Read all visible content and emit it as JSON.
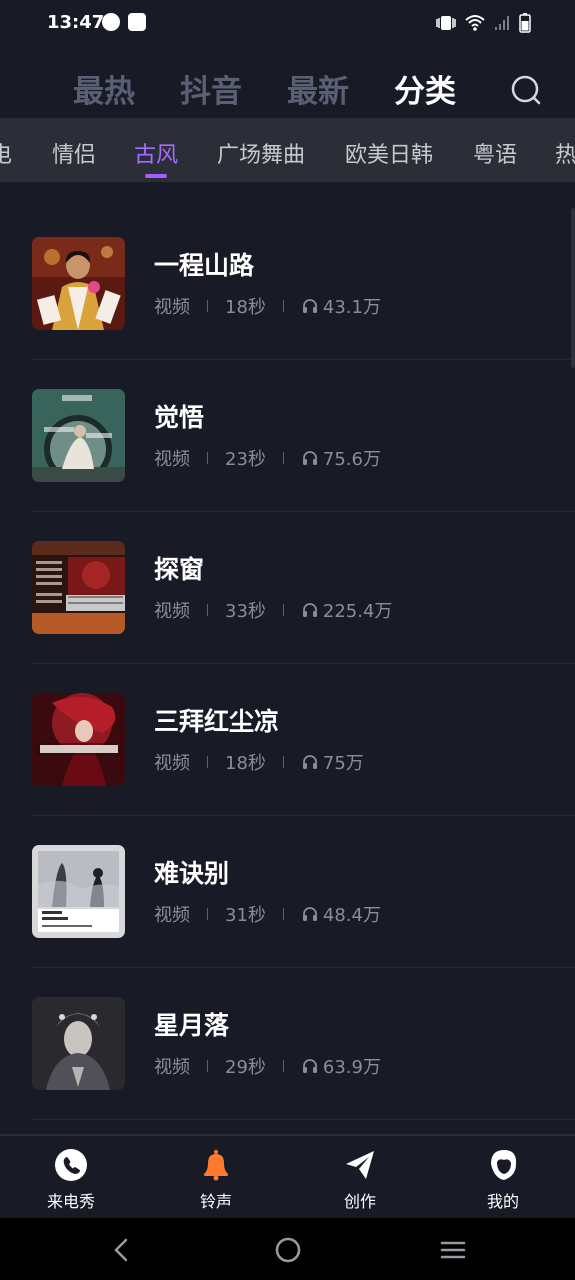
{
  "status": {
    "time": "13:47"
  },
  "top_tabs": [
    {
      "label": "最热"
    },
    {
      "label": "抖音"
    },
    {
      "label": "最新"
    },
    {
      "label": "分类",
      "active": true
    }
  ],
  "categories": [
    {
      "label": "电"
    },
    {
      "label": "情侣"
    },
    {
      "label": "古风",
      "active": true
    },
    {
      "label": "广场舞曲"
    },
    {
      "label": "欧美日韩"
    },
    {
      "label": "粤语"
    },
    {
      "label": "热"
    }
  ],
  "songs": [
    {
      "title": "一程山路",
      "type": "视频",
      "duration": "18秒",
      "plays": "43.1万"
    },
    {
      "title": "觉悟",
      "type": "视频",
      "duration": "23秒",
      "plays": "75.6万"
    },
    {
      "title": "探窗",
      "type": "视频",
      "duration": "33秒",
      "plays": "225.4万"
    },
    {
      "title": "三拜红尘凉",
      "type": "视频",
      "duration": "18秒",
      "plays": "75万"
    },
    {
      "title": "难诀别",
      "type": "视频",
      "duration": "31秒",
      "plays": "48.4万"
    },
    {
      "title": "星月落",
      "type": "视频",
      "duration": "29秒",
      "plays": "63.9万"
    }
  ],
  "bottom_nav": [
    {
      "label": "来电秀",
      "icon": "phone-icon"
    },
    {
      "label": "铃声",
      "icon": "bell-icon",
      "active": true
    },
    {
      "label": "创作",
      "icon": "paper-plane-icon"
    },
    {
      "label": "我的",
      "icon": "profile-icon"
    }
  ],
  "colors": {
    "accent": "#a35cff",
    "background": "#181b26",
    "bell": "#ff7a2e"
  }
}
